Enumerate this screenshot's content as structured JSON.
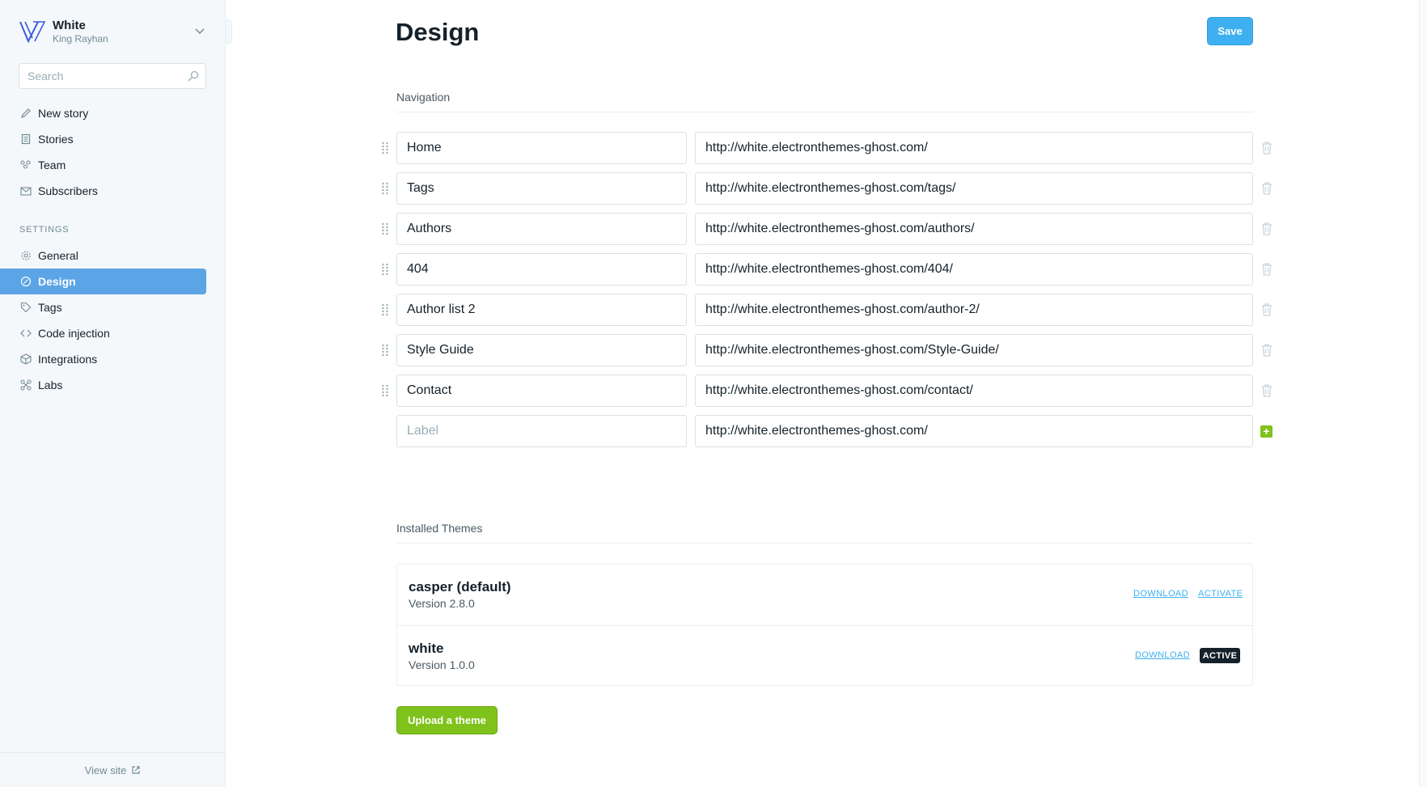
{
  "sidebar": {
    "brand": {
      "name": "White",
      "user": "King Rayhan"
    },
    "search": {
      "placeholder": "Search"
    },
    "main_items": [
      {
        "label": "New story",
        "icon": "pencil-icon"
      },
      {
        "label": "Stories",
        "icon": "document-icon"
      },
      {
        "label": "Team",
        "icon": "team-icon"
      },
      {
        "label": "Subscribers",
        "icon": "envelope-icon"
      }
    ],
    "settings_label": "SETTINGS",
    "settings_items": [
      {
        "label": "General",
        "icon": "gear-icon"
      },
      {
        "label": "Design",
        "icon": "design-icon",
        "active": true
      },
      {
        "label": "Tags",
        "icon": "tag-icon"
      },
      {
        "label": "Code injection",
        "icon": "code-icon"
      },
      {
        "label": "Integrations",
        "icon": "cube-icon"
      },
      {
        "label": "Labs",
        "icon": "labs-icon"
      }
    ],
    "view_site": "View site"
  },
  "header": {
    "title": "Design",
    "save_label": "Save"
  },
  "navigation": {
    "title": "Navigation",
    "items": [
      {
        "label": "Home",
        "url": "http://white.electronthemes-ghost.com/"
      },
      {
        "label": "Tags",
        "url": "http://white.electronthemes-ghost.com/tags/"
      },
      {
        "label": "Authors",
        "url": "http://white.electronthemes-ghost.com/authors/"
      },
      {
        "label": "404",
        "url": "http://white.electronthemes-ghost.com/404/"
      },
      {
        "label": "Author list 2",
        "url": "http://white.electronthemes-ghost.com/author-2/"
      },
      {
        "label": "Style Guide",
        "url": "http://white.electronthemes-ghost.com/Style-Guide/"
      },
      {
        "label": "Contact",
        "url": "http://white.electronthemes-ghost.com/contact/"
      }
    ],
    "new_item": {
      "label_placeholder": "Label",
      "url": "http://white.electronthemes-ghost.com/"
    }
  },
  "themes": {
    "title": "Installed Themes",
    "items": [
      {
        "name": "casper (default)",
        "version": "Version 2.8.0",
        "download": "DOWNLOAD",
        "action": "ACTIVATE"
      },
      {
        "name": "white",
        "version": "Version 1.0.0",
        "download": "DOWNLOAD",
        "badge": "ACTIVE"
      }
    ],
    "upload_label": "Upload a theme"
  },
  "colors": {
    "accent": "#3eb0ef",
    "active_nav": "#5ba4e5",
    "green": "#7fc21b",
    "text": "#15212a"
  }
}
